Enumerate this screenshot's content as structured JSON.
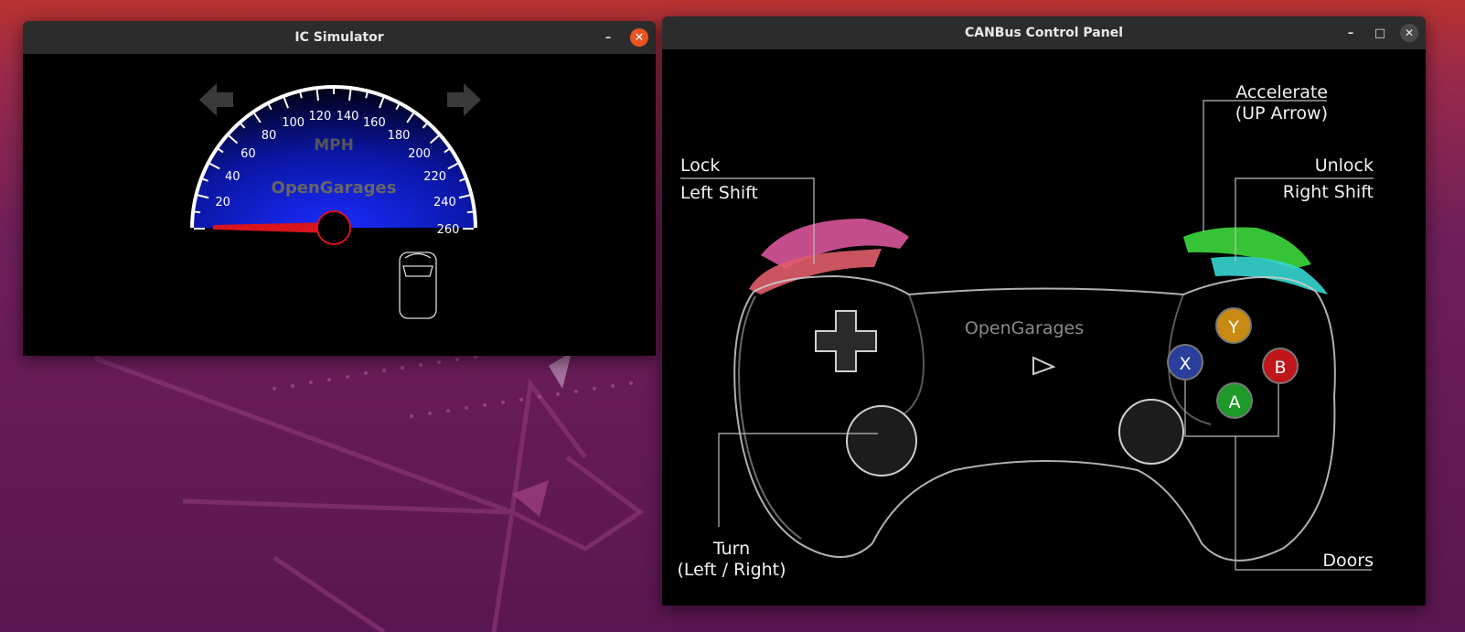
{
  "ic_window": {
    "title": "IC Simulator",
    "minimize": "–",
    "close": "✕",
    "gauge": {
      "unit": "MPH",
      "brand": "OpenGarages",
      "ticks": [
        "20",
        "40",
        "60",
        "80",
        "100",
        "120",
        "140",
        "160",
        "180",
        "200",
        "220",
        "240",
        "260"
      ],
      "speed_value": 0
    }
  },
  "cp_window": {
    "title": "CANBus Control Panel",
    "minimize": "–",
    "maximize": "□",
    "close": "✕",
    "brand": "OpenGarages",
    "labels": {
      "lock": "Lock",
      "left_shift": "Left Shift",
      "accelerate": "Accelerate",
      "up_arrow": "(UP Arrow)",
      "unlock": "Unlock",
      "right_shift": "Right Shift",
      "turn": "Turn",
      "turn_keys": "(Left / Right)",
      "doors": "Doors"
    },
    "buttons": {
      "y": "Y",
      "x": "X",
      "b": "B",
      "a": "A"
    },
    "colors": {
      "lock": "#e0558a",
      "accelerate": "#3cd93c",
      "unlock": "#35d6d0",
      "y": "#c88a10",
      "x": "#2a3f9c",
      "b": "#c0161a",
      "a": "#1d9a28"
    }
  }
}
